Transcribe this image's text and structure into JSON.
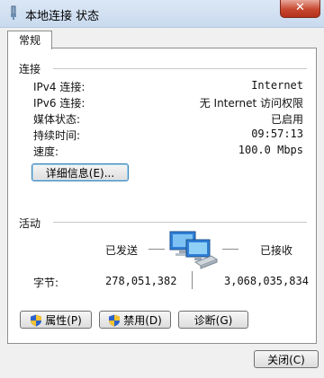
{
  "window": {
    "title": "本地连接 状态",
    "close_glyph": "✕"
  },
  "tabs": [
    {
      "label": "常规"
    }
  ],
  "connection": {
    "heading": "连接",
    "rows": [
      {
        "label": "IPv4 连接:",
        "value": "Internet"
      },
      {
        "label": "IPv6 连接:",
        "value": "无 Internet 访问权限"
      },
      {
        "label": "媒体状态:",
        "value": "已启用"
      },
      {
        "label": "持续时间:",
        "value": "09:57:13"
      },
      {
        "label": "速度:",
        "value": "100.0 Mbps"
      }
    ],
    "details_button": "详细信息(E)..."
  },
  "activity": {
    "heading": "活动",
    "sent_label": "已发送",
    "received_label": "已接收",
    "bytes_label": "字节:",
    "bytes_sent": "278,051,382",
    "bytes_received": "3,068,035,834"
  },
  "buttons": {
    "properties": "属性(P)",
    "disable": "禁用(D)",
    "diagnose": "诊断(G)",
    "close": "关闭(C)"
  },
  "colors": {
    "shield_blue": "#2a62c9",
    "shield_yellow": "#f3c230"
  }
}
